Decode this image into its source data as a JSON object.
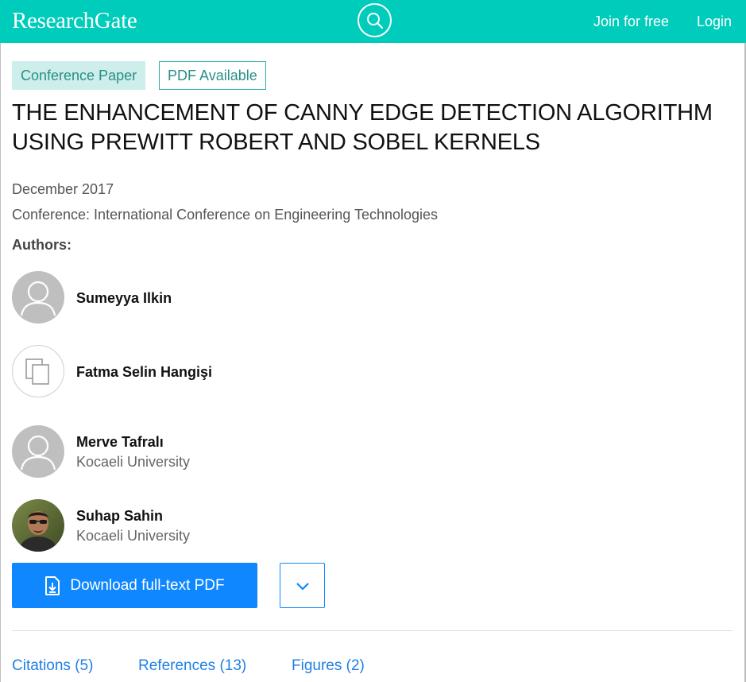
{
  "header": {
    "logo": "ResearchGate",
    "join_label": "Join for free",
    "login_label": "Login",
    "search_icon": "search-icon",
    "background": "#00ccbb"
  },
  "paper": {
    "type_badge": "Conference Paper",
    "pdf_badge": "PDF Available",
    "title": "THE ENHANCEMENT OF CANNY EDGE DETECTION ALGORITHM USING PREWITT ROBERT AND SOBEL KERNELS",
    "date": "December 2017",
    "conference": "Conference: International Conference on Engineering Technologies",
    "authors_label": "Authors:"
  },
  "authors": [
    {
      "name": "Sumeyya Ilkin",
      "affiliation": "",
      "avatar": "default-avatar-icon"
    },
    {
      "name": "Fatma Selin Hangişi",
      "affiliation": "",
      "avatar": "copy-pages-icon"
    },
    {
      "name": "Merve Tafralı",
      "affiliation": "Kocaeli University",
      "avatar": "default-avatar-icon"
    },
    {
      "name": "Suhap Sahin",
      "affiliation": "Kocaeli University",
      "avatar": "photo-avatar"
    }
  ],
  "actions": {
    "download_label": "Download full-text PDF",
    "download_icon": "file-download-icon",
    "more_icon": "chevron-down-icon",
    "accent": "#0f87ff"
  },
  "tabs": [
    {
      "label": "Citations (5)"
    },
    {
      "label": "References (13)"
    },
    {
      "label": "Figures (2)"
    }
  ]
}
